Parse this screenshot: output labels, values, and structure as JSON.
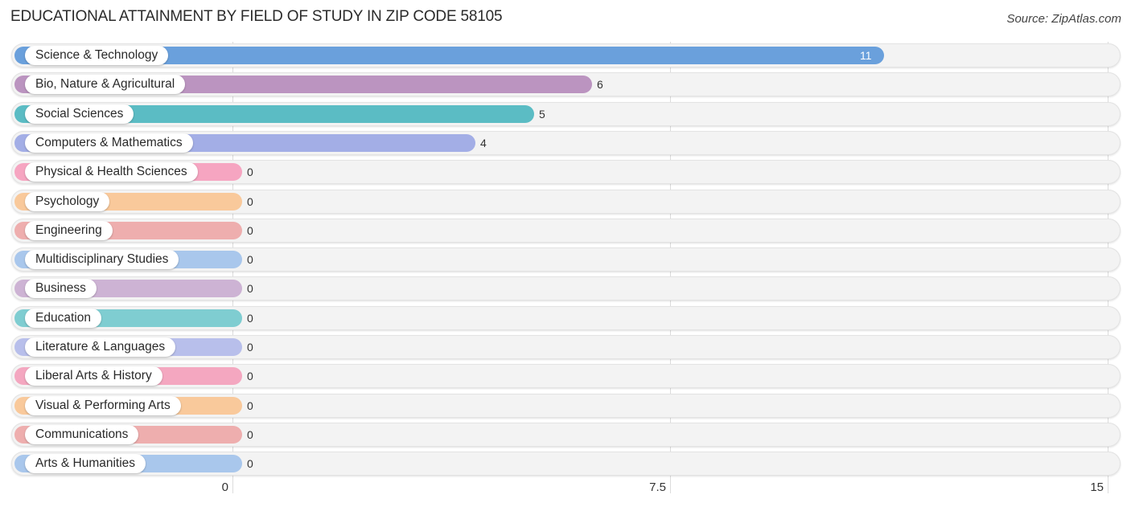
{
  "header": {
    "title": "EDUCATIONAL ATTAINMENT BY FIELD OF STUDY IN ZIP CODE 58105",
    "source": "Source: ZipAtlas.com"
  },
  "chart_data": {
    "type": "bar",
    "orientation": "horizontal",
    "title": "EDUCATIONAL ATTAINMENT BY FIELD OF STUDY IN ZIP CODE 58105",
    "source": "Source: ZipAtlas.com",
    "xlabel": "",
    "ylabel": "",
    "xlim": [
      0,
      15
    ],
    "xticks": [
      0,
      7.5,
      15
    ],
    "xtick_labels": [
      "0",
      "7.5",
      "15"
    ],
    "grid": true,
    "legend": "none",
    "categories": [
      "Science & Technology",
      "Bio, Nature & Agricultural",
      "Social Sciences",
      "Computers & Mathematics",
      "Physical & Health Sciences",
      "Psychology",
      "Engineering",
      "Multidisciplinary Studies",
      "Business",
      "Education",
      "Literature & Languages",
      "Liberal Arts & History",
      "Visual & Performing Arts",
      "Communications",
      "Arts & Humanities"
    ],
    "values": [
      11,
      6,
      5,
      4,
      0,
      0,
      0,
      0,
      0,
      0,
      0,
      0,
      0,
      0,
      0
    ],
    "value_labels": [
      "11",
      "6",
      "5",
      "4",
      "0",
      "0",
      "0",
      "0",
      "0",
      "0",
      "0",
      "0",
      "0",
      "0",
      "0"
    ],
    "colors": [
      "#6aa0dc",
      "#bb94c0",
      "#5bbcc4",
      "#a3aee6",
      "#f6a5c1",
      "#f9c99b",
      "#eeaeae",
      "#a9c7ec",
      "#cdb3d4",
      "#7fcdd1",
      "#b8bfeb",
      "#f4a7c0",
      "#f9c99b",
      "#eeaeae",
      "#a9c7ec"
    ]
  }
}
